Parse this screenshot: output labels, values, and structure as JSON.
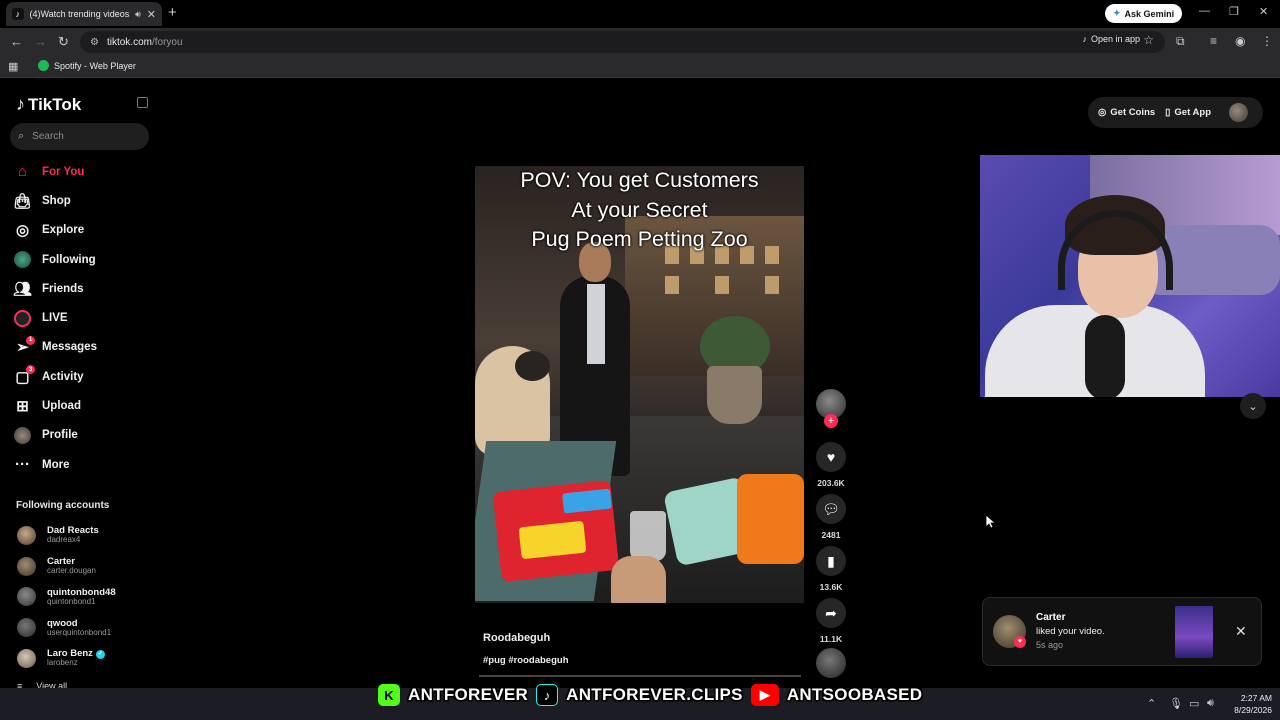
{
  "browser": {
    "tab_title": "(4)Watch trending videos for you",
    "url_domain": "tiktok.com",
    "url_path": "/foryou",
    "ask_gemini_label": "Ask Gemini",
    "open_in_app_label": "Open in app",
    "bookmark_label": "Spotify - Web Player"
  },
  "app": {
    "logo_text": "TikTok",
    "search_placeholder": "Search"
  },
  "nav": [
    {
      "label": "For You",
      "icon": "home-icon"
    },
    {
      "label": "Shop",
      "icon": "shopping-bag-icon"
    },
    {
      "label": "Explore",
      "icon": "compass-icon"
    },
    {
      "label": "Following",
      "icon": "following-avatar-icon"
    },
    {
      "label": "Friends",
      "icon": "friends-icon"
    },
    {
      "label": "LIVE",
      "icon": "live-icon"
    },
    {
      "label": "Messages",
      "icon": "send-icon",
      "badge": "1"
    },
    {
      "label": "Activity",
      "icon": "message-square-icon",
      "badge": "3"
    },
    {
      "label": "Upload",
      "icon": "plus-square-icon"
    },
    {
      "label": "Profile",
      "icon": "profile-avatar-icon"
    },
    {
      "label": "More",
      "icon": "more-dots-icon"
    }
  ],
  "following_accounts": {
    "title": "Following accounts",
    "items": [
      {
        "name": "Dad Reacts",
        "username": "dadreax4"
      },
      {
        "name": "Carter",
        "username": "carter.dougan"
      },
      {
        "name": "quintonbond48",
        "username": "quintonbond1"
      },
      {
        "name": "qwood",
        "username": "userquintonbond1"
      },
      {
        "name": "Laro Benz",
        "username": "larobenz",
        "verified": true
      }
    ],
    "view_all": "View all"
  },
  "header_actions": {
    "get_coins": "Get Coins",
    "get_app": "Get App"
  },
  "video": {
    "overlay_lines": [
      "POV: You get Customers",
      "At your Secret",
      "Pug Poem Petting Zoo"
    ],
    "author": "Roodabeguh",
    "tags": "#pug #roodabeguh",
    "likes": "203.6K",
    "comments": "2481",
    "saves": "13.6K",
    "shares": "11.1K"
  },
  "notification": {
    "name": "Carter",
    "message": "liked your video.",
    "time": "5s ago"
  },
  "taskbar": {
    "time": "2:27 AM",
    "date": "8/29/2026"
  },
  "stream_banner": {
    "kick": "ANTFOREVER",
    "tiktok": "ANTFOREVER.CLIPS",
    "youtube": "ANTSOOBASED"
  },
  "colors": {
    "accent": "#fe2c55",
    "background": "#000000",
    "kick_green": "#53fc18",
    "youtube_red": "#ff0000"
  }
}
